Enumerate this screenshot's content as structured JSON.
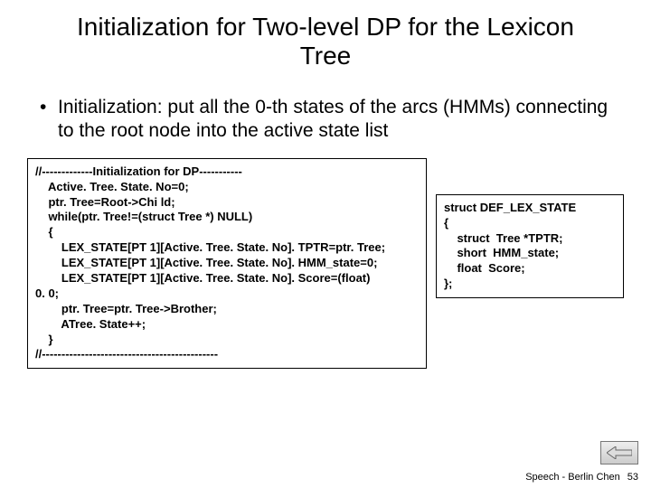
{
  "title": "Initialization for Two-level DP for the Lexicon Tree",
  "bullet": {
    "dot": "•",
    "text": "Initialization: put all the 0-th states of the arcs (HMMs) connecting to the root node into the active state list"
  },
  "code_left": "//-------------Initialization for DP-----------\n    Active. Tree. State. No=0;\n    ptr. Tree=Root->Chi ld;\n    while(ptr. Tree!=(struct Tree *) NULL)\n    {\n        LEX_STATE[PT 1][Active. Tree. State. No]. TPTR=ptr. Tree;\n        LEX_STATE[PT 1][Active. Tree. State. No]. HMM_state=0;\n        LEX_STATE[PT 1][Active. Tree. State. No]. Score=(float)\n0. 0;\n        ptr. Tree=ptr. Tree->Brother;\n        ATree. State++;\n    }\n//---------------------------------------------",
  "code_right": "struct DEF_LEX_STATE\n{\n    struct  Tree *TPTR;\n    short  HMM_state;\n    float  Score;\n};",
  "footer": {
    "text": "Speech - Berlin Chen",
    "page": "53"
  }
}
